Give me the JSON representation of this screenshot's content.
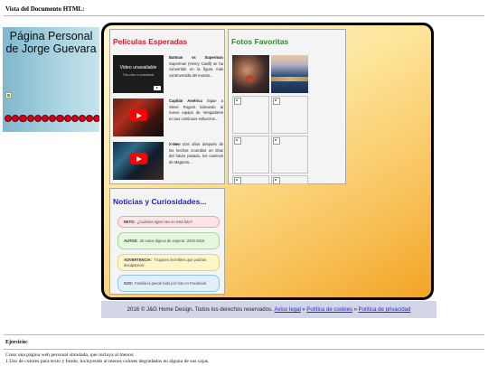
{
  "document_heading": "Vista del Documento HTML:",
  "header": {
    "title_line1": "Página Personal",
    "title_line2": "de Jorge Guevara",
    "dot_count": 13
  },
  "peliculas": {
    "title": "Películas Esperadas",
    "unavailable_title": "Video unavailable",
    "unavailable_sub": "This video is unavailable",
    "movies": [
      {
        "name": "Batman vs Superman",
        "text": "Superman (Henry Cavill) se ha convertido en la figura más controvertida del mundo..."
      },
      {
        "name": "Capitán América",
        "text": "Sigue a Steve Rogers liderando al nuevo equipo de Vengadores en sus continuos esfuerzos..."
      },
      {
        "name": "X-Men",
        "text": "Dos años después de los hechos ocurridos en Días del futuro pasado, los caminos de Magneto..."
      }
    ]
  },
  "fotos": {
    "title": "Fotos Favoritas"
  },
  "noticias": {
    "title": "Noticias y Curiosidades...",
    "items": [
      {
        "label": "RETO:",
        "text": "¿Cuántos tigres ves en esta foto?"
      },
      {
        "label": "AUTOS:",
        "text": "25 Autos dignos de esperar: 2016-2019."
      },
      {
        "label": "ADVERTENCIA:",
        "text": "7 lugares increíbles que podrían desaparecer."
      },
      {
        "label": "OJO:",
        "text": "Familia la pierde todo por foto en Facebook."
      }
    ]
  },
  "footer": {
    "copyright": "2016 © J&G Home Design. Todos los derechos reservados.",
    "link_legal": "Aviso legal",
    "separator": "»",
    "link_cookies": "Política de cookies",
    "link_privacy": "Política de privacidad"
  },
  "exercise": {
    "heading": "Ejercicio:",
    "line1": "Crear una página web personal simulada, que incluya al menos:",
    "line2": "1.Uso de colores para texto y fondo, incluyendo al menos colores degradados en alguna de sus cajas."
  }
}
